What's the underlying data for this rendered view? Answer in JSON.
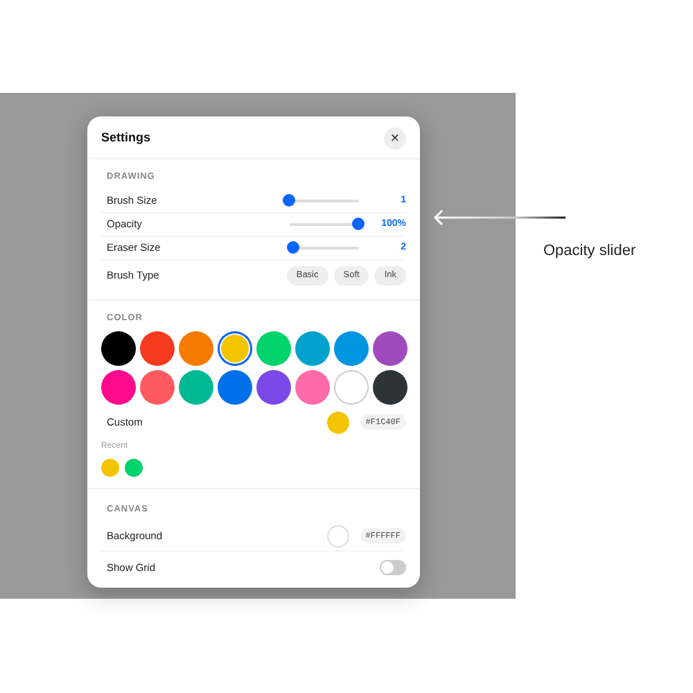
{
  "dialog": {
    "title": "Settings",
    "close": "×"
  },
  "drawing": {
    "heading": "DRAWING",
    "sliders": [
      {
        "label": "Brush Size",
        "level": 0.0,
        "reading": "1"
      },
      {
        "label": "Opacity",
        "level": 1.0,
        "reading": "100%"
      },
      {
        "label": "Eraser Size",
        "level": 0.05,
        "reading": "2"
      }
    ],
    "brush_type": {
      "label": "Brush Type",
      "options": [
        {
          "label": "Basic",
          "selected": false
        },
        {
          "label": "Soft",
          "selected": false
        },
        {
          "label": "Ink",
          "selected": false
        }
      ]
    }
  },
  "color": {
    "heading": "COLOR",
    "swatches": [
      {
        "color": "#000000",
        "selected": false
      },
      {
        "color": "#f63a1e",
        "selected": false
      },
      {
        "color": "#f47b00",
        "selected": false
      },
      {
        "color": "#f5c400",
        "selected": true
      },
      {
        "color": "#00d36b",
        "selected": false
      },
      {
        "color": "#00a3cc",
        "selected": false
      },
      {
        "color": "#0095e0",
        "selected": false
      },
      {
        "color": "#a04bbd",
        "selected": false
      },
      {
        "color": "#ff0a8c",
        "selected": false
      },
      {
        "color": "#ff5a5f",
        "selected": false
      },
      {
        "color": "#00b894",
        "selected": false
      },
      {
        "color": "#0070e8",
        "selected": false
      },
      {
        "color": "#7b48e8",
        "selected": false
      },
      {
        "color": "#ff6ba8",
        "selected": false
      },
      {
        "color": "#ffffff",
        "selected": false
      },
      {
        "color": "#2d3436",
        "selected": false
      }
    ],
    "custom": {
      "label": "Custom",
      "color": "#f5c400",
      "hex": "#F1C40F"
    },
    "recent": {
      "label": "Recent",
      "swatches": [
        {
          "color": "#f5c400"
        },
        {
          "color": "#00d36b"
        }
      ]
    }
  },
  "canvas": {
    "heading": "CANVAS",
    "background": {
      "label": "Background",
      "color": "#ffffff",
      "hex": "#FFFFFF"
    },
    "show_grid": {
      "label": "Show Grid",
      "on": false
    }
  },
  "annotation": {
    "label": "Opacity slider"
  }
}
